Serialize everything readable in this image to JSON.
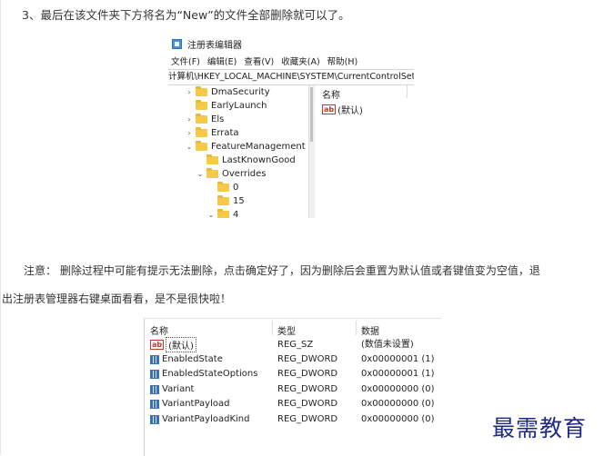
{
  "article": {
    "step3": "3、最后在该文件夹下方将名为“New”的文件全部删除就可以了。",
    "note_line1": "注意： 删除过程中可能有提示无法删除，点击确定好了，因为删除后会重置为默认值或者键值变为空值，退",
    "note_line2": "出注册表管理器右键桌面看看，是不是很快啦！"
  },
  "regedit": {
    "title": "注册表编辑器",
    "menu": [
      "文件(F)",
      "编辑(E)",
      "查看(V)",
      "收藏夹(A)",
      "帮助(H)"
    ],
    "address": "计算机\\HKEY_LOCAL_MACHINE\\SYSTEM\\CurrentControlSet\\C",
    "tree": [
      {
        "label": "DmaSecurity",
        "arrow": "›"
      },
      {
        "label": "EarlyLaunch",
        "arrow": ""
      },
      {
        "label": "Els",
        "arrow": "›"
      },
      {
        "label": "Errata",
        "arrow": "›"
      },
      {
        "label": "FeatureManagement",
        "arrow": "⌄"
      },
      {
        "label": "LastKnownGood",
        "arrow": ""
      },
      {
        "label": "Overrides",
        "arrow": "⌄"
      },
      {
        "label": "0",
        "arrow": ""
      },
      {
        "label": "15",
        "arrow": ""
      },
      {
        "label": "4",
        "arrow": "⌄"
      }
    ],
    "values_header": "名称",
    "values_row": "(默认)",
    "values_icon": "ab"
  },
  "values_table": {
    "headers": [
      "名称",
      "类型",
      "数据"
    ],
    "rows": [
      {
        "name": "(默认)",
        "type": "REG_SZ",
        "data": "(数值未设置)",
        "icon": "ab"
      },
      {
        "name": "EnabledState",
        "type": "REG_DWORD",
        "data": "0x00000001 (1)",
        "icon": "dword"
      },
      {
        "name": "EnabledStateOptions",
        "type": "REG_DWORD",
        "data": "0x00000001 (1)",
        "icon": "dword"
      },
      {
        "name": "Variant",
        "type": "REG_DWORD",
        "data": "0x00000000 (0)",
        "icon": "dword"
      },
      {
        "name": "VariantPayload",
        "type": "REG_DWORD",
        "data": "0x00000000 (0)",
        "icon": "dword"
      },
      {
        "name": "VariantPayloadKind",
        "type": "REG_DWORD",
        "data": "0x00000000 (0)",
        "icon": "dword"
      }
    ]
  },
  "watermark": "最需教育",
  "colors": {
    "watermark": "#1f2a88",
    "folder": "#f7c948",
    "string_icon": "#c0392b",
    "dword_icon": "#3b6fb6"
  }
}
